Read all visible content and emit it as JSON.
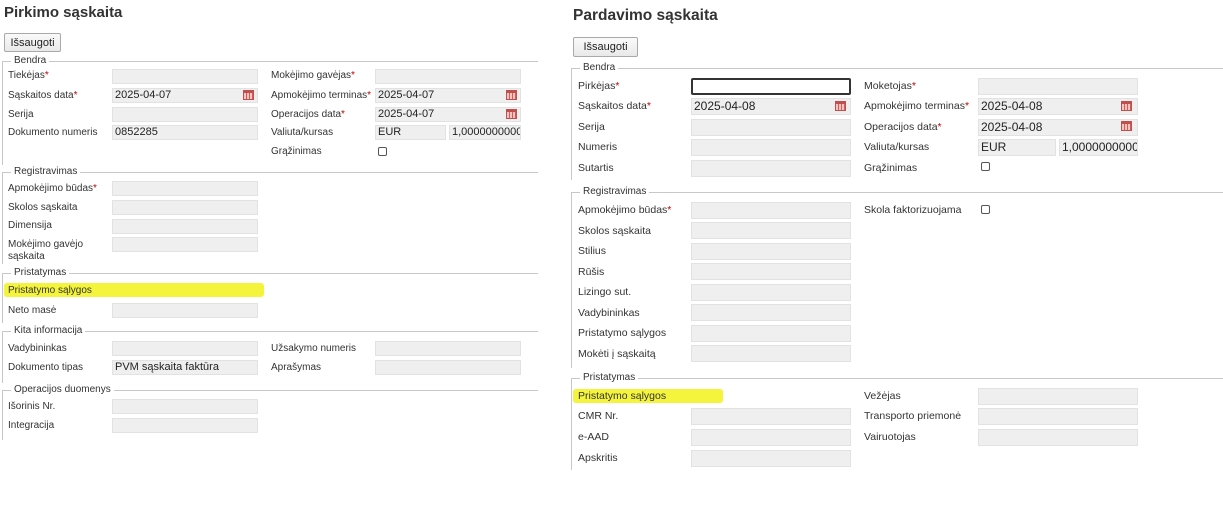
{
  "purchase": {
    "title": "Pirkimo sąskaita",
    "save_label": "Išsaugoti",
    "sections": {
      "general": "Bendra",
      "registration": "Registravimas",
      "delivery": "Pristatymas",
      "other": "Kita informacija",
      "operations": "Operacijos duomenys"
    },
    "fields": {
      "supplier": "Tiekėjas",
      "invoice_date": "Sąskaitos data",
      "invoice_date_value": "2025-04-07",
      "series": "Serija",
      "document_number": "Dokumento numeris",
      "document_number_value": "0852285",
      "payee": "Mokėjimo gavėjas",
      "payment_term": "Apmokėjimo terminas",
      "payment_term_value": "2025-04-07",
      "operation_date": "Operacijos data",
      "operation_date_value": "2025-04-07",
      "currency_rate": "Valiuta/kursas",
      "currency_value": "EUR",
      "rate_value": "1,0000000000",
      "return": "Grąžinimas",
      "payment_method": "Apmokėjimo būdas",
      "debt_account": "Skolos sąskaita",
      "dimension": "Dimensija",
      "payee_account_1": "Mokėjimo gavėjo",
      "payee_account_2": "sąskaita",
      "delivery_terms": "Pristatymo sąlygos",
      "net_weight": "Neto masė",
      "manager": "Vadybininkas",
      "document_type": "Dokumento tipas",
      "document_type_value": "PVM sąskaita faktūra",
      "order_number": "Užsakymo numeris",
      "description": "Aprašymas",
      "external_no": "Išorinis Nr.",
      "integration": "Integracija"
    }
  },
  "sales": {
    "title": "Pardavimo sąskaita",
    "save_label": "Išsaugoti",
    "sections": {
      "general": "Bendra",
      "registration": "Registravimas",
      "delivery": "Pristatymas"
    },
    "fields": {
      "buyer": "Pirkėjas",
      "invoice_date": "Sąskaitos data",
      "invoice_date_value": "2025-04-08",
      "series": "Serija",
      "number": "Numeris",
      "contract": "Sutartis",
      "payer": "Moketojas",
      "payment_term": "Apmokėjimo terminas",
      "payment_term_value": "2025-04-08",
      "operation_date": "Operacijos data",
      "operation_date_value": "2025-04-08",
      "currency_rate": "Valiuta/kursas",
      "currency_value": "EUR",
      "rate_value": "1,0000000000",
      "return": "Grąžinimas",
      "payment_method": "Apmokėjimo būdas",
      "debt_factoring": "Skola faktorizuojama",
      "debt_account": "Skolos sąskaita",
      "style": "Stilius",
      "kind": "Rūšis",
      "leasing": "Lizingo sut.",
      "manager": "Vadybininkas",
      "delivery_terms_reg": "Pristatymo sąlygos",
      "pay_to_account": "Mokėti į sąskaitą",
      "delivery_terms": "Pristatymo sąlygos",
      "cmr": "CMR Nr.",
      "eaad": "e-AAD",
      "district": "Apskritis",
      "carrier": "Vežėjas",
      "vehicle": "Transporto priemonė",
      "driver": "Vairuotojas"
    }
  },
  "colors": {
    "required_mark": "#c00000",
    "highlight": "#f3f21a",
    "input_bg": "#efefef"
  }
}
